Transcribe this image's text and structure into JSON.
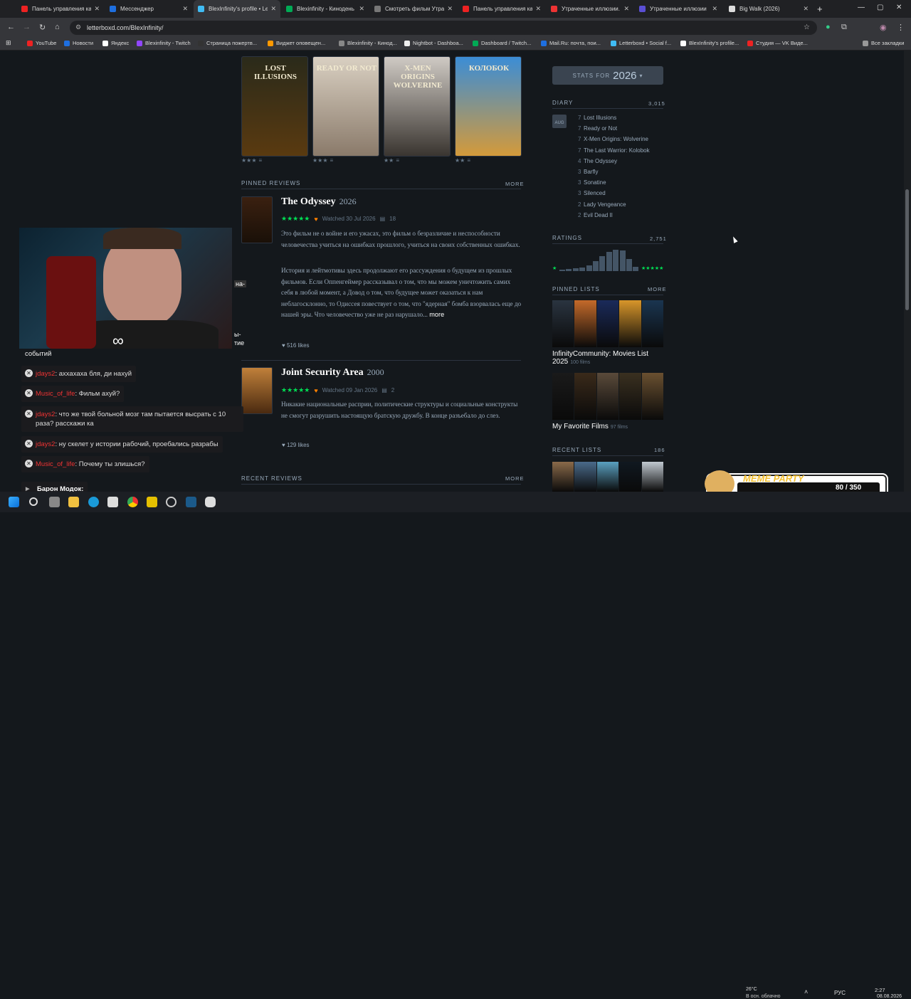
{
  "tabs": [
    {
      "title": "Панель управления ка",
      "color": "#e22"
    },
    {
      "title": "Мессенджер",
      "color": "#1e6fe0"
    },
    {
      "title": "BlexInfinity's profile • Le",
      "color": "#40bcf4"
    },
    {
      "title": "Blexinfinity - Кинодень",
      "color": "#0a5"
    },
    {
      "title": "Смотреть фильм Утраче",
      "color": "#777"
    },
    {
      "title": "Панель управления ка",
      "color": "#e22"
    },
    {
      "title": "Утраченные иллюзии.",
      "color": "#e33"
    },
    {
      "title": "Утраченные иллюзии",
      "color": "#5a4fd4"
    },
    {
      "title": "Big Walk (2026)",
      "color": "#ddd"
    }
  ],
  "address": {
    "url": "letterboxd.com/BlexInfinity/"
  },
  "bookmarks": [
    {
      "label": "YouTube",
      "color": "#e22"
    },
    {
      "label": "Новости",
      "color": "#1e6fe0"
    },
    {
      "label": "Яндекс",
      "color": "#fff"
    },
    {
      "label": "Blexinfinity - Twitch",
      "color": "#9146ff"
    },
    {
      "label": "Страница пожертв...",
      "color": "#333"
    },
    {
      "label": "Виджет оповещен...",
      "color": "#f90"
    },
    {
      "label": "Blexinfinity - Кинод...",
      "color": "#888"
    },
    {
      "label": "Nightbot - Dashboa...",
      "color": "#eee"
    },
    {
      "label": "Dashboard / Twitch...",
      "color": "#0a5"
    },
    {
      "label": "Mail.Ru: почта, пои...",
      "color": "#1e6fe0"
    },
    {
      "label": "Letterboxd • Social f...",
      "color": "#40bcf4"
    },
    {
      "label": "BlexInfinity's profile...",
      "color": "#fff"
    },
    {
      "label": "Студия — VK Виде...",
      "color": "#e22"
    },
    {
      "label": "Все закладки",
      "color": "#999"
    }
  ],
  "favorites": [
    {
      "title": "LOST ILLUSIONS",
      "rating": "★★★",
      "top": "#2a2a1a",
      "bot": "#5a3a10"
    },
    {
      "title": "READY OR NOT",
      "rating": "★★★",
      "top": "#d9d0c2",
      "bot": "#8a7a6a"
    },
    {
      "title": "X-MEN ORIGINS WOLVERINE",
      "rating": "★★",
      "top": "#cfcac4",
      "bot": "#3a3530"
    },
    {
      "title": "КОЛОБОК",
      "rating": "★★",
      "top": "#3b8dd6",
      "bot": "#d49a3a"
    }
  ],
  "pinned_reviews": {
    "heading": "PINNED REVIEWS",
    "more": "MORE",
    "items": [
      {
        "title": "The Odyssey",
        "year": "2026",
        "stars": "★★★★★",
        "watched": "Watched  30 Jul 2026",
        "comments": "18",
        "body1": "Это фильм не о войне и его ужасах, это фильм о безразличие и неспособности человечества учиться на ошибках прошлого, учиться на своих собственных ошибках.",
        "body2": "История и лейтмотивы здесь продолжают его рассуждения о будущем из прошлых фильмов. Если Оппенгеймер рассказывал о том, что мы можем уничтожить самих себя в любой момент, а Довод о том, что будущее может оказаться к нам неблагосклонно, то Одиссея повествует о том, что \"ядерная\" бомба взорвалась еще до нашей эры. Что человечество уже не раз нарушало...",
        "more": "more",
        "likes": "516 likes"
      },
      {
        "title": "Joint Security Area",
        "year": "2000",
        "stars": "★★★★★",
        "watched": "Watched  09 Jan 2026",
        "comments": "2",
        "body1": "Никакие национальные расприи, политические структуры и социальные конструкты не смогут разрушить настоящую братскую дружбу. В конце разъебало до слез.",
        "likes": "129 likes"
      }
    ]
  },
  "recent_reviews": {
    "heading": "RECENT REVIEWS",
    "more": "MORE"
  },
  "sidebar": {
    "stats_label": "STATS FOR",
    "stats_year": "2026",
    "diary_heading": "DIARY",
    "diary_count": "3,015",
    "month": "AUG",
    "diary": [
      {
        "day": "7",
        "title": "Lost Illusions"
      },
      {
        "day": "7",
        "title": "Ready or Not"
      },
      {
        "day": "7",
        "title": "X-Men Origins: Wolverine"
      },
      {
        "day": "7",
        "title": "The Last Warrior: Kolobok"
      },
      {
        "day": "4",
        "title": "The Odyssey"
      },
      {
        "day": "3",
        "title": "Barfly"
      },
      {
        "day": "3",
        "title": "Sonatine"
      },
      {
        "day": "3",
        "title": "Silenced"
      },
      {
        "day": "2",
        "title": "Lady Vengeance"
      },
      {
        "day": "2",
        "title": "Evil Dead II"
      }
    ],
    "ratings_heading": "RATINGS",
    "ratings_count": "2,751",
    "rating_lo": "★",
    "rating_hi": "★★★★★",
    "ratings_dist": [
      0.05,
      0.1,
      0.12,
      0.15,
      0.25,
      0.45,
      0.7,
      0.9,
      1.0,
      0.95,
      0.55,
      0.2
    ],
    "pinned_lists_heading": "PINNED LISTS",
    "pinned_lists_more": "MORE",
    "lists": [
      {
        "title": "InfinityCommunity: Movies List 2025",
        "count": "100 films",
        "colors": [
          "#2a3440",
          "#c46a2a",
          "#1a2a5a",
          "#d8962a",
          "#1a3550"
        ]
      },
      {
        "title": "My Favorite Films",
        "count": "97 films",
        "colors": [
          "#1a1a1a",
          "#3a2a1a",
          "#5a4a3a",
          "#3a3020",
          "#6a5030"
        ]
      }
    ],
    "recent_lists_heading": "RECENT LISTS",
    "recent_lists_count": "186",
    "recent_colors": [
      "#8a6a4a",
      "#4a6a8a",
      "#5aa0c0",
      "#101820",
      "#c0c8d0"
    ]
  },
  "overlay": {
    "partial1": "на-",
    "partial2": "ы-",
    "partial3": "тие",
    "events": "событий",
    "chat": [
      {
        "user": "jdays2",
        "msg": "аххахаха бля, ди нахуй"
      },
      {
        "user": "Music_of_life",
        "msg": "Фильм ахуй?"
      },
      {
        "user": "jdays2",
        "msg": "что же твой больной мозг там пытается высрать с 10 раза? расскажи ка"
      },
      {
        "user": "jdays2",
        "msg": "ну скелет у истории рабочий, проебались разрабы"
      },
      {
        "user": "Music_of_life",
        "msg": "Почему ты злишься?"
      }
    ],
    "donor": "Барон Модок:",
    "meme_title": "MEME PARTY",
    "meme_count": "80 / 350"
  },
  "taskbar": {
    "weather": "26°C",
    "weather_desc": "В осн. облачно",
    "lang": "РУС",
    "time": "2:27",
    "date": "08.08.2026"
  }
}
